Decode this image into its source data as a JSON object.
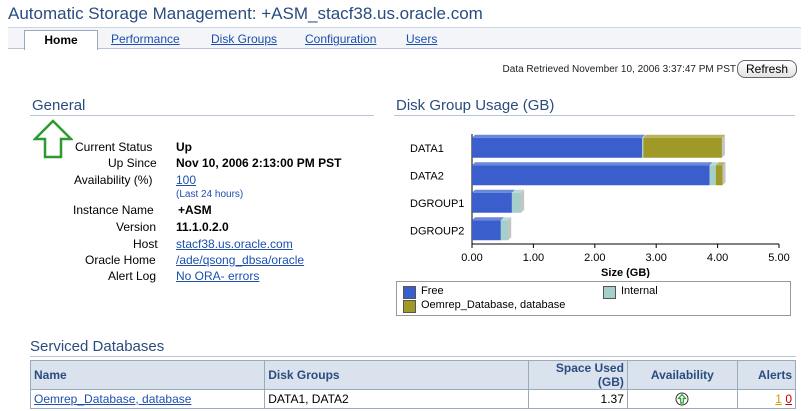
{
  "page": {
    "title": "Automatic Storage Management: +ASM_stacf38.us.oracle.com"
  },
  "tabs": [
    {
      "label": "Home",
      "active": true
    },
    {
      "label": "Performance"
    },
    {
      "label": "Disk Groups"
    },
    {
      "label": "Configuration"
    },
    {
      "label": "Users"
    }
  ],
  "header": {
    "retrieved": "Data Retrieved November 10, 2006 3:37:47 PM PST",
    "refresh_label": "Refresh"
  },
  "general": {
    "heading": "General",
    "status_icon": "up-arrow-icon",
    "rows": [
      {
        "label": "Current Status",
        "value": "Up"
      },
      {
        "label": "Up Since",
        "value": "Nov 10, 2006 2:13:00 PM PST"
      },
      {
        "label": "Availability (%)",
        "value": "100",
        "note": "(Last 24 hours)"
      },
      {
        "label": "Instance Name",
        "value": "+ASM"
      },
      {
        "label": "Version",
        "value": "11.1.0.2.0"
      },
      {
        "label": "Host",
        "value": "stacf38.us.oracle.com"
      },
      {
        "label": "Oracle Home",
        "value": "/ade/qsong_dbsa/oracle"
      },
      {
        "label": "Alert Log",
        "value": "No ORA- errors"
      }
    ]
  },
  "disk_group_usage": {
    "heading": "Disk Group Usage (GB)",
    "colors": {
      "free": "#3a5fcd",
      "internal": "#a4cfcb",
      "database": "#9f9a28"
    }
  },
  "chart_data": {
    "type": "bar",
    "orientation": "horizontal",
    "stacked": true,
    "categories": [
      "DATA1",
      "DATA2",
      "DGROUP1",
      "DGROUP2"
    ],
    "series": [
      {
        "name": "Free",
        "values": [
          2.77,
          3.87,
          0.65,
          0.47
        ]
      },
      {
        "name": "Internal",
        "values": [
          0.02,
          0.1,
          0.15,
          0.12
        ]
      },
      {
        "name": "Oemrep_Database, database",
        "values": [
          1.28,
          0.11,
          0.0,
          0.0
        ]
      }
    ],
    "xlabel": "Size (GB)",
    "xlim": [
      0,
      5
    ],
    "ticks": [
      "0.00",
      "1.00",
      "2.00",
      "3.00",
      "4.00",
      "5.00"
    ],
    "grid": false,
    "legend": "bottom"
  },
  "serviced_databases": {
    "heading": "Serviced Databases",
    "columns": [
      "Name",
      "Disk Groups",
      "Space Used (GB)",
      "Availability",
      "Alerts"
    ],
    "rows": [
      {
        "name": "Oemrep_Database, database",
        "disk_groups": "DATA1, DATA2",
        "space_used": "1.37",
        "availability_icon": "up-arrow-circle-icon",
        "alerts_warning": "1",
        "alerts_critical": "0"
      }
    ]
  }
}
